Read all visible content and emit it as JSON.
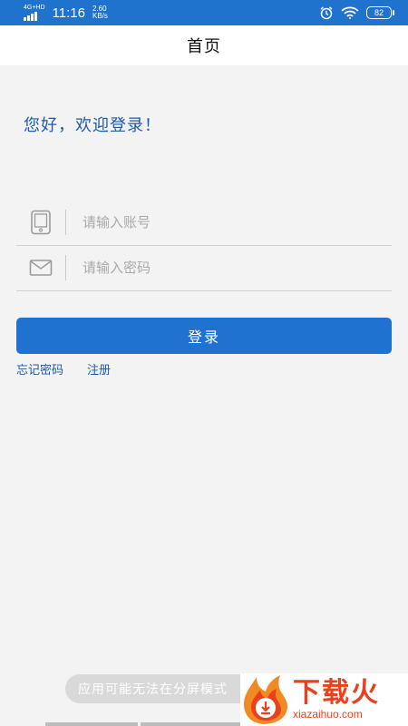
{
  "status_bar": {
    "network": "4G+HD",
    "time": "11:16",
    "speed_value": "2.60",
    "speed_unit": "KB/s",
    "battery": "82"
  },
  "header": {
    "title": "首页"
  },
  "login": {
    "welcome": "您好，欢迎登录！",
    "account_placeholder": "请输入账号",
    "password_placeholder": "请输入密码",
    "login_button": "登录",
    "forgot_password": "忘记密码",
    "register": "注册"
  },
  "toast": {
    "text": "应用可能无法在分屏模式"
  },
  "watermark": {
    "title": "下载火",
    "subtitle": "xiazaihuo.com"
  },
  "colors": {
    "primary": "#1f72cf",
    "link": "#1e5aa6",
    "background": "#f3f3f3"
  }
}
